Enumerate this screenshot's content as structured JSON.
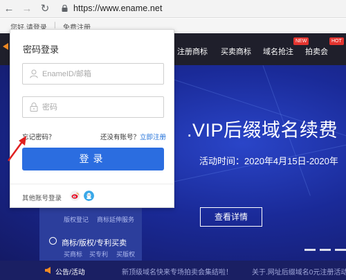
{
  "browser": {
    "url": "https://www.ename.net",
    "back_icon": "arrow-left-icon",
    "forward_icon": "arrow-right-icon",
    "reload_icon": "reload-icon",
    "lock_icon": "lock-icon"
  },
  "site_top": {
    "greeting": "您好,请登录",
    "separator": "|",
    "free_register": "免费注册"
  },
  "nav": {
    "items": [
      "注册商标",
      "买卖商标",
      "域名抢注",
      "拍卖会"
    ],
    "badges": {
      "new": "NEW",
      "hot": "HOT"
    }
  },
  "banner": {
    "title": ".VIP后缀域名续费",
    "subtitle": "活动时间：2020年4月15日-2020年",
    "button": "查看详情"
  },
  "service_panel": {
    "links_row1": [
      "版权登记",
      "商标延伸服务"
    ],
    "heading": "商标/版权/专利买卖",
    "links_row2": [
      "买商标",
      "买专利",
      "买版权"
    ]
  },
  "notice": {
    "label": "公告/活动",
    "items": [
      "新顶级域名快来专场拍卖会集结啦！",
      "关于.网址后缀域名0元注册活动"
    ]
  },
  "login": {
    "title": "密码登录",
    "username_placeholder": "EnameID/邮箱",
    "password_placeholder": "密码",
    "forgot": "忘记密码？",
    "no_account": "还没有账号？",
    "register_link": "立即注册",
    "submit": "登录",
    "other_login": "其他账号登录",
    "user_icon": "user-icon",
    "lock_icon": "lock-icon",
    "weibo_icon": "weibo-icon",
    "qq_icon": "qq-icon"
  },
  "colors": {
    "nav_bg": "#1f1f2b",
    "banner_bg": "#1a2a98",
    "primary_button": "#2b6de0",
    "link": "#1e6fd9",
    "annotation_arrow": "#e02020",
    "badge": "#e3342f"
  }
}
